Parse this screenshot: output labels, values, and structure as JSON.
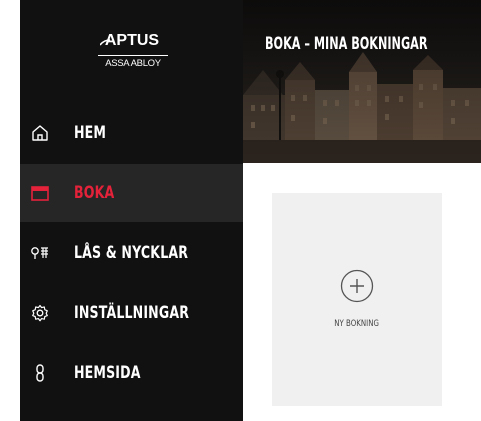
{
  "brand": {
    "logo_main": "APTUS",
    "logo_sub": "ASSA ABLOY"
  },
  "sidebar": {
    "items": [
      {
        "label": "HEM",
        "icon": "home-icon",
        "active": false
      },
      {
        "label": "BOKA",
        "icon": "calendar-icon",
        "active": true
      },
      {
        "label": "LÅS & NYCKLAR",
        "icon": "key-lock-icon",
        "active": false
      },
      {
        "label": "INSTÄLLNINGAR",
        "icon": "gear-icon",
        "active": false
      },
      {
        "label": "HEMSIDA",
        "icon": "link-icon",
        "active": false
      }
    ]
  },
  "header": {
    "title": "BOKA – MINA BOKNINGAR"
  },
  "main": {
    "new_booking_label": "NY BOKNING"
  },
  "colors": {
    "sidebar_bg": "#111111",
    "active_item_bg": "#262626",
    "accent": "#e4223a",
    "card_bg": "#f0f0f0"
  }
}
